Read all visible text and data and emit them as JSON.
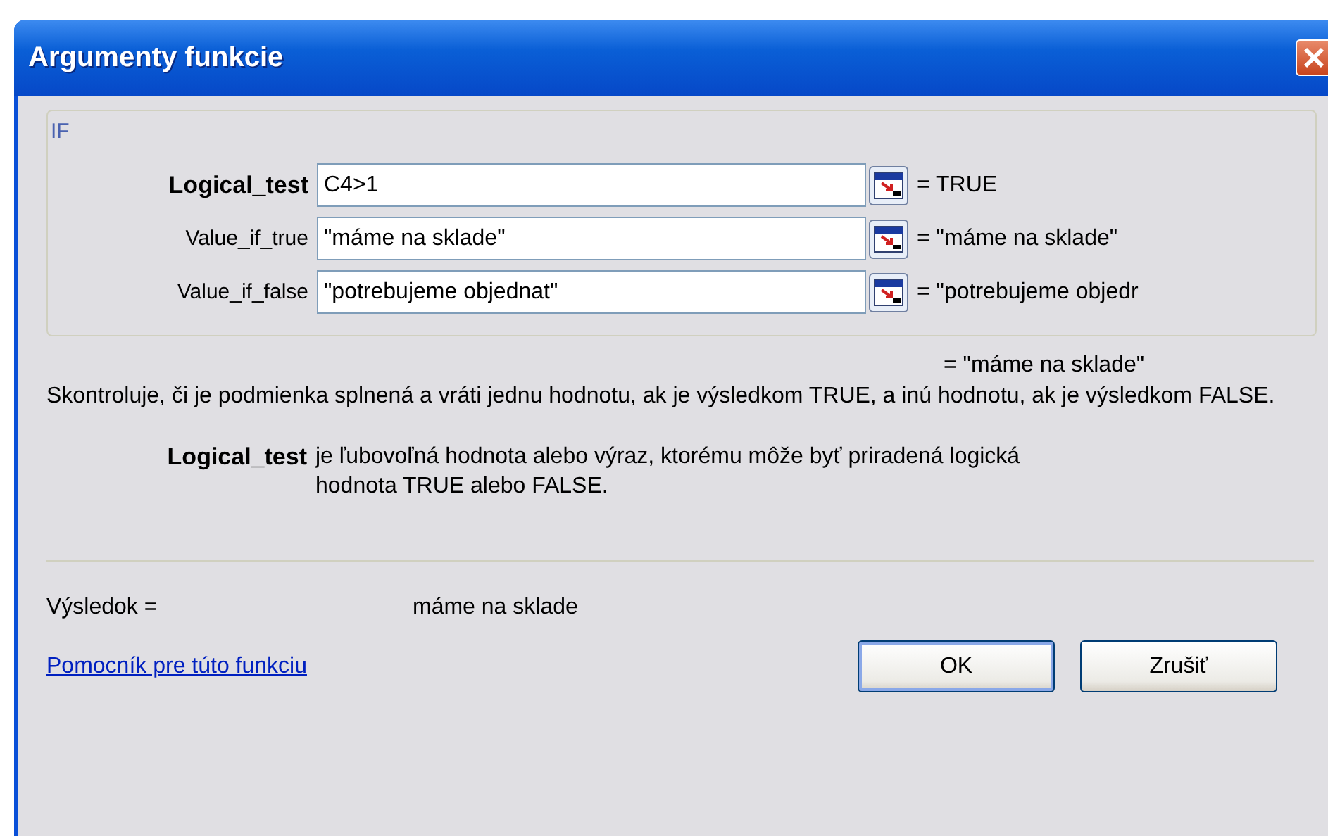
{
  "window": {
    "title": "Argumenty funkcie"
  },
  "function_name": "IF",
  "arguments": [
    {
      "label": "Logical_test",
      "value": "C4>1",
      "result": "= TRUE",
      "selected": true
    },
    {
      "label": "Value_if_true",
      "value": "\"máme na sklade\"",
      "result": "= \"máme na sklade\"",
      "selected": false
    },
    {
      "label": "Value_if_false",
      "value": "\"potrebujeme objednat\"",
      "result": "= \"potrebujeme objedr",
      "selected": false
    }
  ],
  "formula_result": "= \"máme na sklade\"",
  "description": "Skontroluje, či je podmienka splnená a vráti jednu hodnotu, ak je výsledkom TRUE, a inú hodnotu, ak je výsledkom FALSE.",
  "argument_help": {
    "name": "Logical_test",
    "text": "je ľubovoľná hodnota alebo výraz, ktorému môže byť priradená logická hodnota TRUE alebo FALSE."
  },
  "result": {
    "label": "Výsledok =",
    "value": "máme na sklade"
  },
  "help_link": "Pomocník pre túto funkciu",
  "buttons": [
    {
      "label": "OK",
      "default": true
    },
    {
      "label": "Zrušiť",
      "default": false
    }
  ]
}
